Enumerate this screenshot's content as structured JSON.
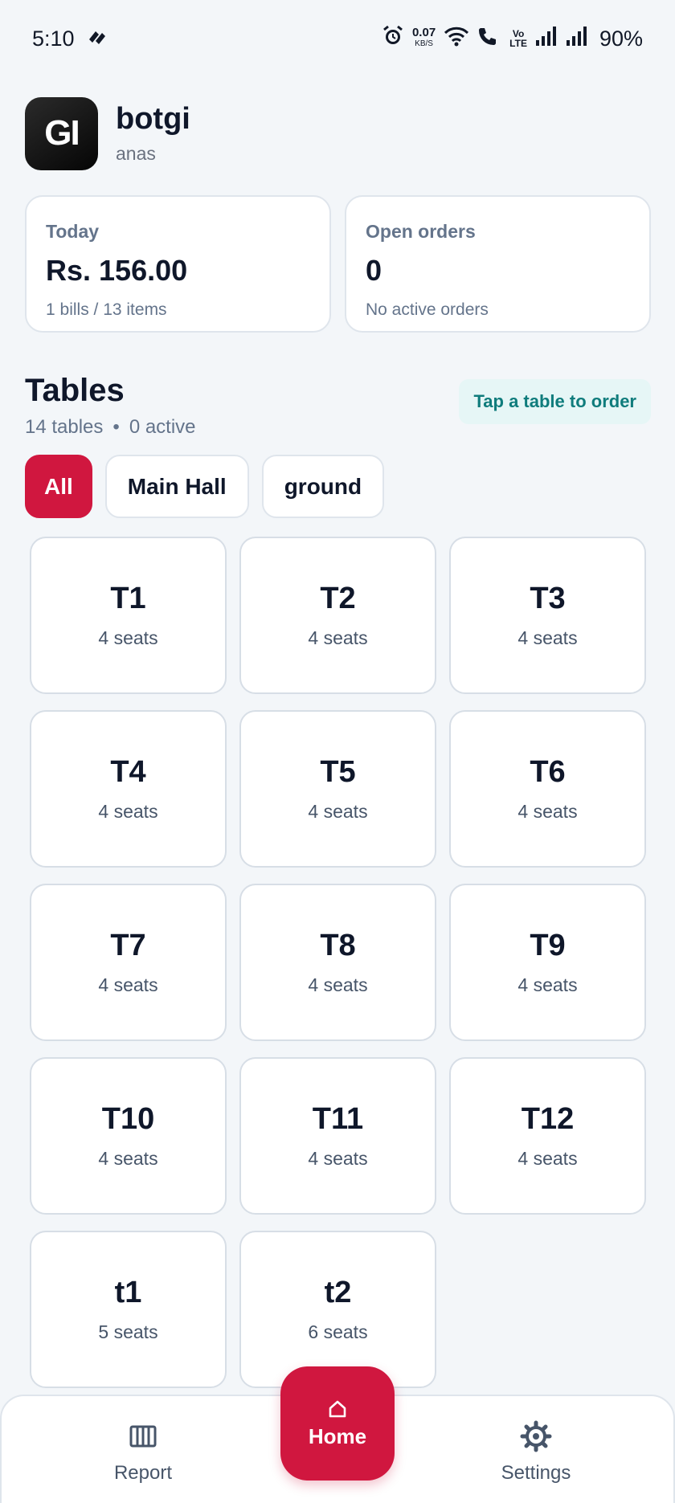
{
  "status_bar": {
    "time": "5:10",
    "net_speed": "0.07",
    "net_unit": "KB/S",
    "volte": "Vo\nLTE",
    "battery": "90%"
  },
  "header": {
    "logo_text": "GI",
    "brand_name": "botgi",
    "user_name": "anas"
  },
  "stats": {
    "today": {
      "label": "Today",
      "value": "Rs. 156.00",
      "sub": "1 bills / 13 items"
    },
    "open_orders": {
      "label": "Open orders",
      "value": "0",
      "sub": "No active orders"
    }
  },
  "tables_section": {
    "title": "Tables",
    "count_text": "14 tables",
    "active_text": "0 active",
    "hint": "Tap a table to order"
  },
  "filters": [
    {
      "label": "All",
      "active": true
    },
    {
      "label": "Main Hall",
      "active": false
    },
    {
      "label": "ground",
      "active": false
    }
  ],
  "tables": [
    {
      "name": "T1",
      "seats": "4 seats"
    },
    {
      "name": "T2",
      "seats": "4 seats"
    },
    {
      "name": "T3",
      "seats": "4 seats"
    },
    {
      "name": "T4",
      "seats": "4 seats"
    },
    {
      "name": "T5",
      "seats": "4 seats"
    },
    {
      "name": "T6",
      "seats": "4 seats"
    },
    {
      "name": "T7",
      "seats": "4 seats"
    },
    {
      "name": "T8",
      "seats": "4 seats"
    },
    {
      "name": "T9",
      "seats": "4 seats"
    },
    {
      "name": "T10",
      "seats": "4 seats"
    },
    {
      "name": "T11",
      "seats": "4 seats"
    },
    {
      "name": "T12",
      "seats": "4 seats"
    },
    {
      "name": "t1",
      "seats": "5 seats"
    },
    {
      "name": "t2",
      "seats": "6 seats"
    }
  ],
  "nav": {
    "report": "Report",
    "home": "Home",
    "settings": "Settings"
  },
  "colors": {
    "accent": "#d0173f",
    "hint_bg": "#e6f6f6",
    "hint_text": "#0f7c7c"
  }
}
